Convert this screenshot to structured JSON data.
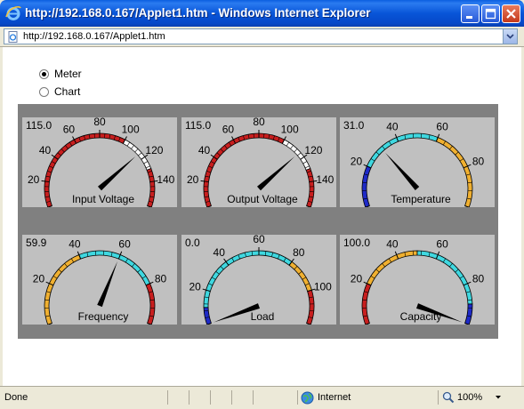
{
  "window": {
    "title": "http://192.168.0.167/Applet1.htm - Windows Internet Explorer",
    "address": "http://192.168.0.167/Applet1.htm"
  },
  "view_options": [
    {
      "label": "Meter",
      "selected": true
    },
    {
      "label": "Chart",
      "selected": false
    }
  ],
  "gauges": [
    {
      "label": "Input Voltage",
      "readout": "115.0",
      "value": 115.0,
      "min": 0,
      "max": 160,
      "ticks": [
        "0",
        "20",
        "40",
        "60",
        "80",
        "100",
        "120",
        "140",
        "160"
      ],
      "bands": [
        {
          "from": 0,
          "to": 100,
          "color": "#C81E1E"
        },
        {
          "from": 100,
          "to": 130,
          "color": "#FFFFFF"
        },
        {
          "from": 130,
          "to": 160,
          "color": "#C81E1E"
        }
      ]
    },
    {
      "label": "Output Voltage",
      "readout": "115.0",
      "value": 115.0,
      "min": 0,
      "max": 160,
      "ticks": [
        "0",
        "20",
        "40",
        "60",
        "80",
        "100",
        "120",
        "140",
        "160"
      ],
      "bands": [
        {
          "from": 0,
          "to": 100,
          "color": "#C81E1E"
        },
        {
          "from": 100,
          "to": 130,
          "color": "#FFFFFF"
        },
        {
          "from": 130,
          "to": 160,
          "color": "#C81E1E"
        }
      ]
    },
    {
      "label": "Temperature",
      "readout": "31.0",
      "value": 31.0,
      "min": 0,
      "max": 100,
      "ticks": [
        "0",
        "20",
        "40",
        "60",
        "80",
        "100"
      ],
      "bands": [
        {
          "from": 0,
          "to": 20,
          "color": "#1E2AC8"
        },
        {
          "from": 20,
          "to": 60,
          "color": "#3FD8E0"
        },
        {
          "from": 60,
          "to": 100,
          "color": "#F0B030"
        }
      ]
    },
    {
      "label": "Frequency",
      "readout": "59.9",
      "value": 59.9,
      "min": 0,
      "max": 100,
      "ticks": [
        "0",
        "20",
        "40",
        "60",
        "80",
        "100"
      ],
      "bands": [
        {
          "from": 0,
          "to": 40,
          "color": "#F0B030"
        },
        {
          "from": 40,
          "to": 80,
          "color": "#3FD8E0"
        },
        {
          "from": 80,
          "to": 100,
          "color": "#C81E1E"
        }
      ]
    },
    {
      "label": "Load",
      "readout": "0.0",
      "value": 0.0,
      "min": 0,
      "max": 120,
      "ticks": [
        "0",
        "20",
        "40",
        "60",
        "80",
        "100",
        "120"
      ],
      "bands": [
        {
          "from": 0,
          "to": 10,
          "color": "#1E2AC8"
        },
        {
          "from": 10,
          "to": 80,
          "color": "#3FD8E0"
        },
        {
          "from": 80,
          "to": 100,
          "color": "#F0B030"
        },
        {
          "from": 100,
          "to": 120,
          "color": "#C81E1E"
        }
      ]
    },
    {
      "label": "Capacity",
      "readout": "100.0",
      "value": 100.0,
      "min": 0,
      "max": 100,
      "ticks": [
        "0",
        "20",
        "40",
        "60",
        "80",
        "100"
      ],
      "bands": [
        {
          "from": 0,
          "to": 20,
          "color": "#C81E1E"
        },
        {
          "from": 20,
          "to": 50,
          "color": "#F0B030"
        },
        {
          "from": 50,
          "to": 90,
          "color": "#3FD8E0"
        },
        {
          "from": 90,
          "to": 100,
          "color": "#1E2AC8"
        }
      ]
    }
  ],
  "status": {
    "text": "Done",
    "zone": "Internet",
    "zoom": "100%"
  },
  "icons": [
    "ie-logo-icon",
    "page-icon",
    "globe-icon",
    "zoom-icon",
    "minimize-icon",
    "maximize-icon",
    "close-icon",
    "dropdown-arrow-icon"
  ]
}
